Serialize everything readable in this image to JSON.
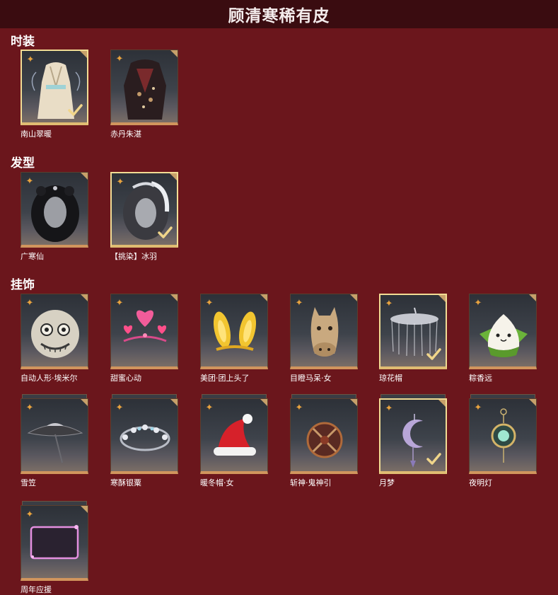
{
  "header": {
    "title": "顾清寒稀有皮"
  },
  "sections": {
    "fashion": {
      "title": "时装"
    },
    "hair": {
      "title": "发型"
    },
    "accessory": {
      "title": "挂饰"
    }
  },
  "items": {
    "nanshan": {
      "label": "南山翠暖",
      "selected": true
    },
    "chidan": {
      "label": "赤丹朱湛",
      "selected": false
    },
    "guanghan": {
      "label": "广寒仙",
      "selected": false
    },
    "bingyu": {
      "label": "【挑染】冰羽",
      "selected": true
    },
    "emil": {
      "label": "自动人形·埃米尔",
      "selected": false
    },
    "tianmi": {
      "label": "甜蜜心动",
      "selected": false
    },
    "meituan": {
      "label": "美团·团上头了",
      "selected": false
    },
    "horse": {
      "label": "目瞪马呆·女",
      "selected": false
    },
    "qionghua": {
      "label": "琼花帽",
      "selected": true
    },
    "zongxiang": {
      "label": "粽香远",
      "selected": false
    },
    "xueli": {
      "label": "雪笠",
      "selected": false
    },
    "hansu": {
      "label": "寒酥银粟",
      "selected": false
    },
    "nuandong": {
      "label": "暖冬帽·女",
      "selected": false
    },
    "zhanshen": {
      "label": "斩神·鬼神引",
      "selected": false
    },
    "yuemeng": {
      "label": "月梦",
      "selected": true
    },
    "yeming": {
      "label": "夜明灯",
      "selected": false
    },
    "zhounian": {
      "label": "周年应援",
      "selected": false
    }
  },
  "icons": {
    "badge": "rare-badge-icon",
    "check": "owned-check-icon"
  },
  "colors": {
    "background": "#6b161c",
    "header": "#3a0c10",
    "badge": "#e8a33f",
    "selected_border": "#f2dc94",
    "card_bottom": "#d1955d"
  }
}
